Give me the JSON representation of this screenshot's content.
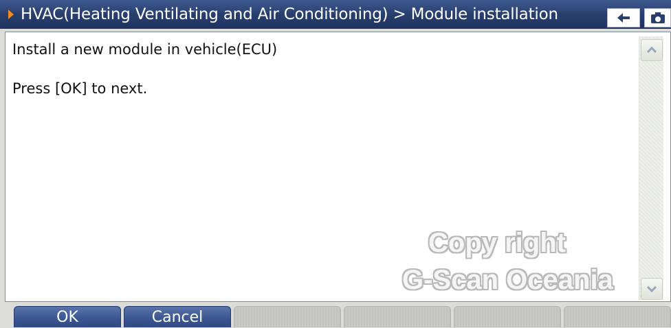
{
  "header": {
    "title": "HVAC(Heating Ventilating and Air Conditioning) > Module installation",
    "back_icon": "back-arrow-icon",
    "camera_icon": "camera-icon",
    "colors": {
      "bar": "#283f6e",
      "accent_arrow": "#f08a1c"
    }
  },
  "content": {
    "lines": [
      "Install a new module in vehicle(ECU)",
      "Press [OK] to next."
    ]
  },
  "watermark": {
    "line1": "Copy right",
    "line2": "G-Scan Oceania"
  },
  "function_keys": [
    {
      "label": "OK",
      "enabled": true
    },
    {
      "label": "Cancel",
      "enabled": true
    },
    {
      "label": "",
      "enabled": false
    },
    {
      "label": "",
      "enabled": false
    },
    {
      "label": "",
      "enabled": false
    },
    {
      "label": "",
      "enabled": false
    }
  ]
}
